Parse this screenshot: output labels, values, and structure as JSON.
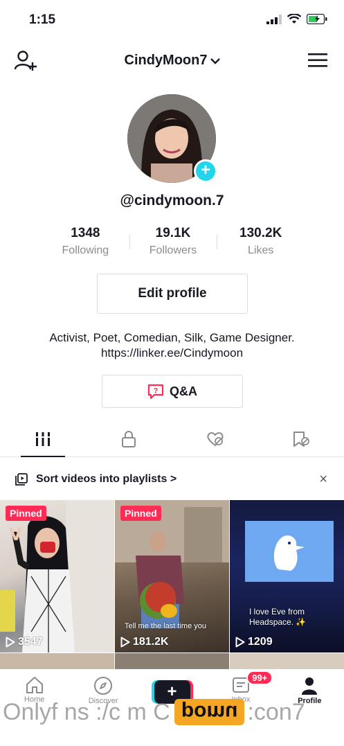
{
  "status_bar": {
    "time": "1:15"
  },
  "header": {
    "username": "CindyMoon7"
  },
  "profile": {
    "handle": "@cindymoon.7",
    "stats": [
      {
        "value": "1348",
        "label": "Following"
      },
      {
        "value": "19.1K",
        "label": "Followers"
      },
      {
        "value": "130.2K",
        "label": "Likes"
      }
    ],
    "edit_profile_label": "Edit profile",
    "bio_line1": "Activist, Poet, Comedian, Silk, Game Designer.",
    "bio_line2": "https://linker.ee/Cindymoon",
    "qa_label": "Q&A"
  },
  "playlist_prompt": {
    "text": "Sort videos into playlists",
    "arrow": ">",
    "close": "×"
  },
  "videos": [
    {
      "pinned": "Pinned",
      "views": "3547",
      "caption": ""
    },
    {
      "pinned": "Pinned",
      "views": "181.2K",
      "caption": "Tell me the last time you"
    },
    {
      "pinned": "",
      "views": "1209",
      "caption": "I love Eve from Headspace. ✨"
    }
  ],
  "nav": {
    "items": [
      {
        "label": "Home",
        "icon": "home-icon"
      },
      {
        "label": "Discover",
        "icon": "compass-icon"
      },
      {
        "label": "",
        "icon": "plus-icon"
      },
      {
        "label": "Inbox",
        "icon": "inbox-icon",
        "badge": "99+"
      },
      {
        "label": "Profile",
        "icon": "person-icon"
      }
    ]
  },
  "watermark": {
    "left": "Onlyf ns :/c m C",
    "logo": "pomu",
    "right": ":con7"
  },
  "colors": {
    "accent_pink": "#fe2c55",
    "accent_cyan": "#20d5ec",
    "text": "#161823",
    "muted": "#8a8b91"
  }
}
